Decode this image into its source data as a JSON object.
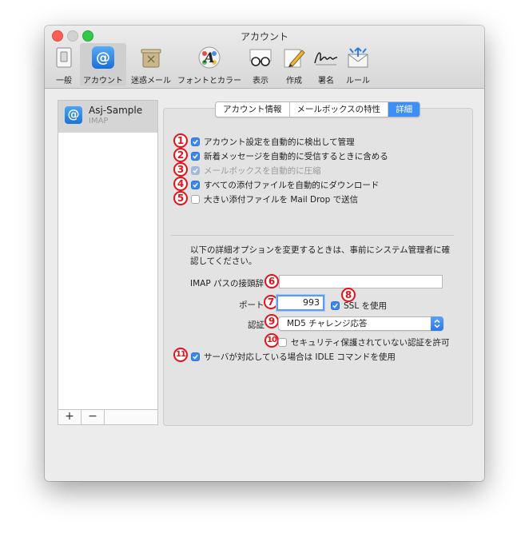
{
  "window": {
    "title": "アカウント"
  },
  "toolbar": {
    "items": [
      {
        "label": "一般",
        "icon": "switch-icon"
      },
      {
        "label": "アカウント",
        "icon": "at-sign-icon",
        "selected": true
      },
      {
        "label": "迷惑メール",
        "icon": "trash-icon"
      },
      {
        "label": "フォントとカラー",
        "icon": "font-palette-icon"
      },
      {
        "label": "表示",
        "icon": "glasses-icon"
      },
      {
        "label": "作成",
        "icon": "pencil-icon"
      },
      {
        "label": "署名",
        "icon": "signature-icon"
      },
      {
        "label": "ルール",
        "icon": "rules-envelope-icon"
      }
    ]
  },
  "sidebar": {
    "account": {
      "name": "Asj-Sample",
      "type": "IMAP",
      "icon": "@"
    },
    "buttons": {
      "add": "+",
      "remove": "−"
    }
  },
  "tabs": [
    "アカウント情報",
    "メールボックスの特性",
    "詳細"
  ],
  "selected_tab": "詳細",
  "options": [
    {
      "label": "アカウント設定を自動的に検出して管理",
      "checked": true,
      "enabled": true,
      "marker": "1"
    },
    {
      "label": "新着メッセージを自動的に受信するときに含める",
      "checked": true,
      "enabled": true,
      "marker": "2"
    },
    {
      "label": "メールボックスを自動的に圧縮",
      "checked": true,
      "enabled": false,
      "marker": "3"
    },
    {
      "label": "すべての添付ファイルを自動的にダウンロード",
      "checked": true,
      "enabled": true,
      "marker": "4"
    },
    {
      "label": "大きい添付ファイルを Mail Drop で送信",
      "checked": false,
      "enabled": true,
      "marker": "5"
    }
  ],
  "info_text": "以下の詳細オプションを変更するときは、事前にシステム管理者に確認してください。",
  "imap_prefix": {
    "label": "IMAP パスの接頭辞",
    "value": "",
    "marker": "6"
  },
  "port": {
    "label": "ポート",
    "value": "993",
    "marker": "7"
  },
  "ssl": {
    "label": "SSL を使用",
    "checked": true,
    "marker": "8"
  },
  "auth": {
    "label": "認証",
    "value": "MD5 チャレンジ応答",
    "marker": "9"
  },
  "insecure_auth": {
    "label": "セキュリティ保護されていない認証を許可",
    "checked": false,
    "marker": "10"
  },
  "idle": {
    "label": "サーバが対応している場合は IDLE コマンドを使用",
    "checked": true,
    "marker": "11"
  },
  "help": {
    "label": "?"
  },
  "colors": {
    "accent": "#3b87f0",
    "marker": "#e8111a"
  }
}
